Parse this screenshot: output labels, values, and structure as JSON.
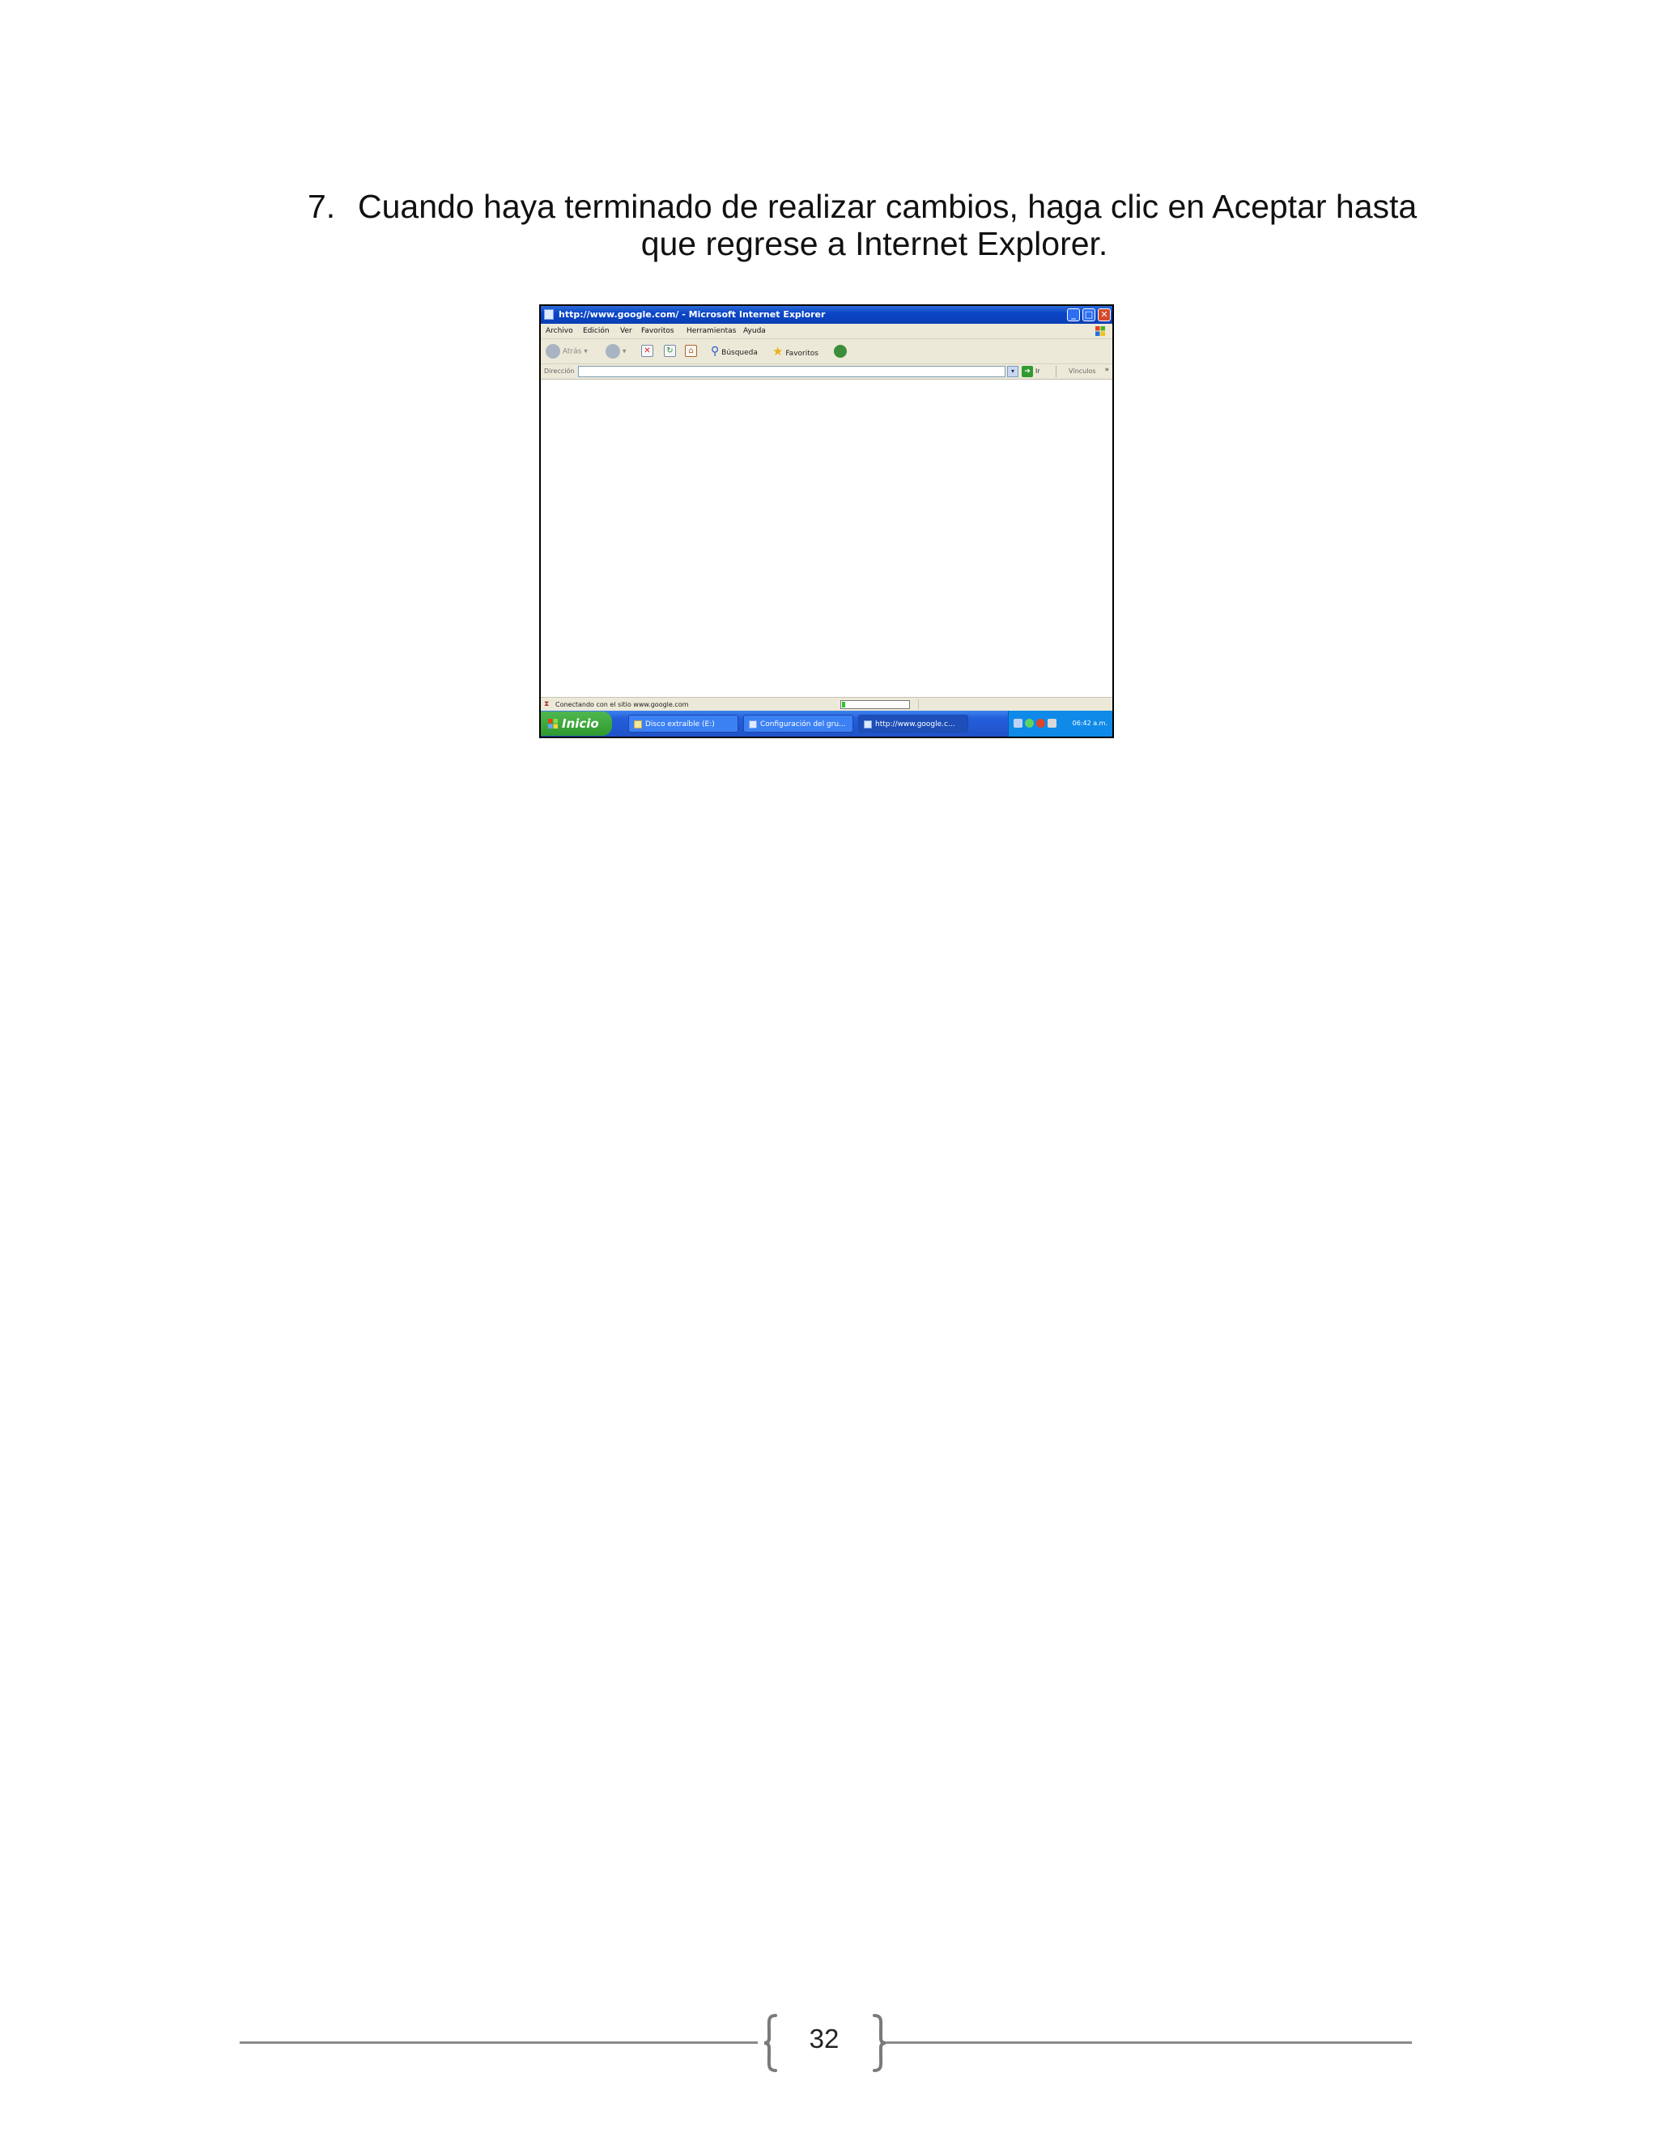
{
  "step": {
    "number": "7.",
    "line1": "Cuando haya terminado de realizar cambios, haga clic en Aceptar hasta",
    "line2": "que regrese a Internet Explorer."
  },
  "screenshot": {
    "window_title": "http://www.google.com/ - Microsoft Internet Explorer",
    "menu": [
      "Archivo",
      "Edición",
      "Ver",
      "Favoritos",
      "Herramientas",
      "Ayuda"
    ],
    "toolbar": {
      "back": "Atrás",
      "search": "Búsqueda",
      "favorites": "Favoritos"
    },
    "address": {
      "label": "Dirección",
      "value": "",
      "go": "Ir",
      "links": "Vínculos"
    },
    "status": {
      "text": "Conectando con el sitio www.google.com",
      "progress": 0.05
    },
    "taskbar": {
      "start": "Inicio",
      "buttons": [
        "Disco extraíble (E:)",
        "Configuración del gru...",
        "http://www.google.c..."
      ],
      "clock": "06:42 a.m."
    },
    "colors": {
      "titlebar": "#0a46c8",
      "taskbar": "#245edb",
      "start": "#2f9a2f",
      "chrome": "#ece9d8"
    }
  },
  "footer": {
    "page_number": "32"
  }
}
